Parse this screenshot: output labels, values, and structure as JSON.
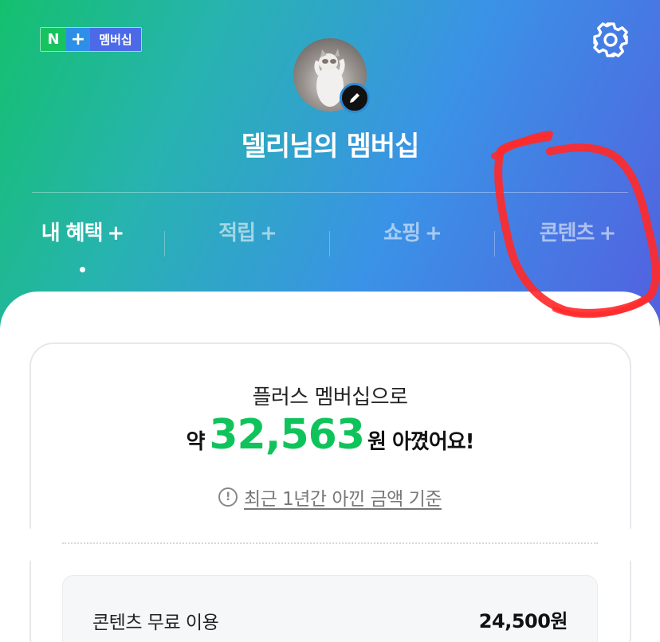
{
  "badge": {
    "n": "N",
    "plus": "+",
    "label": "멤버십"
  },
  "profile": {
    "title": "델리님의 멤버십"
  },
  "tabs": [
    {
      "label": "내 혜택",
      "active": true
    },
    {
      "label": "적립",
      "active": false
    },
    {
      "label": "쇼핑",
      "active": false
    },
    {
      "label": "콘텐츠",
      "active": false
    }
  ],
  "tab_plus": "+",
  "savings": {
    "intro": "플러스 멤버십으로",
    "prefix": "약",
    "amount": "32,563",
    "suffix": "원 아꼈어요!",
    "basis_icon": "!",
    "basis": "최근 1년간 아낀 금액 기준"
  },
  "breakdown": [
    {
      "label": "콘텐츠 무료 이용",
      "value": "24,500원"
    }
  ],
  "colors": {
    "accent_green": "#0fc35b",
    "scribble_red": "#ff2a2a"
  },
  "icons": [
    "gear-icon",
    "pencil-icon",
    "info-icon",
    "plus-icon"
  ]
}
